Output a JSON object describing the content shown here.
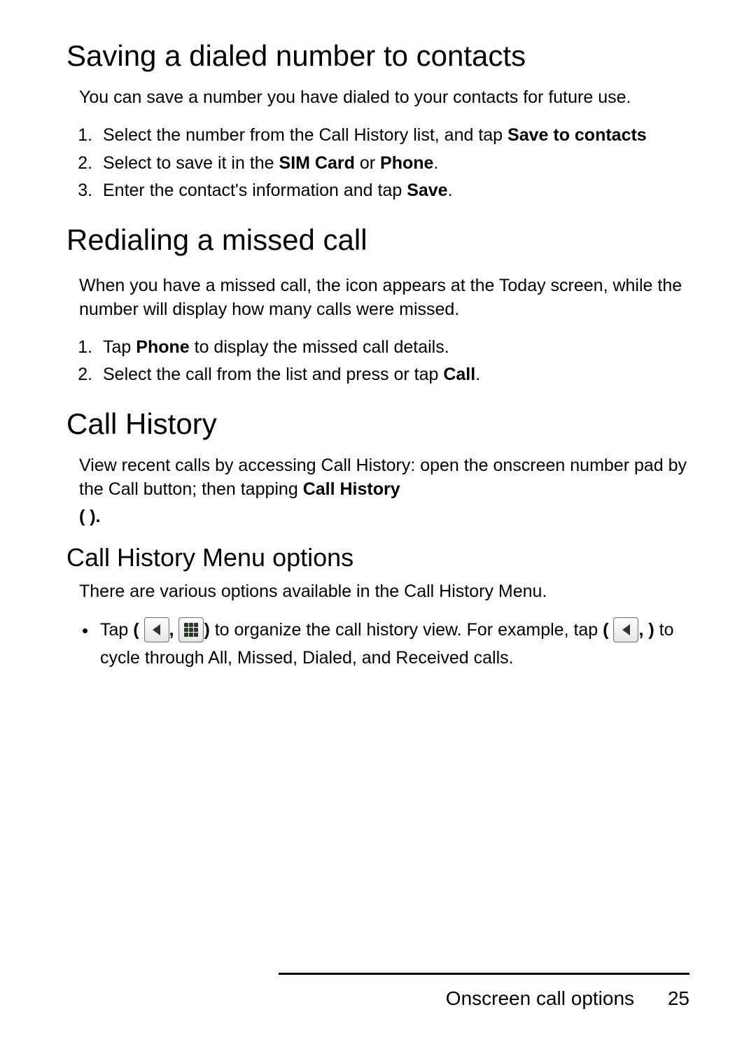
{
  "section1": {
    "heading": "Saving a dialed number to contacts",
    "intro": "You can save a number you have dialed to your contacts for future use.",
    "step1_a": "Select the number from the Call History list, and tap ",
    "step1_b": "Save to contacts",
    "step2_a": "Select to save it in the ",
    "step2_b": "SIM Card",
    "step2_c": " or ",
    "step2_d": "Phone",
    "step2_e": ".",
    "step3_a": "Enter the contact's information and tap ",
    "step3_b": "Save",
    "step3_c": "."
  },
  "section2": {
    "heading": "Redialing a missed call",
    "intro": "When you have a missed call, the        icon appears at the Today screen, while the number will display how many calls were missed.",
    "step1_a": "Tap ",
    "step1_b": "Phone",
    "step1_c": " to display the missed call details.",
    "step2_a": "Select the call from the list and press      or tap ",
    "step2_b": "Call",
    "step2_c": "."
  },
  "section3": {
    "heading": "Call History",
    "intro_a": "View recent calls by accessing Call History: open the onscreen number pad by the Call button; then tapping ",
    "intro_b": "Call History",
    "paren": "(      ).",
    "subheading": "Call History Menu options",
    "subintro": "There are various options available in the Call History Menu.",
    "bullet_a": "Tap ",
    "bullet_b": "( ",
    "bullet_c": ", ",
    "bullet_d": ")",
    "bullet_e": " to organize the call history view. For example, tap ",
    "bullet_f": "( ",
    "bullet_g": ",       )",
    "bullet_h": " to cycle through All, Missed, Dialed, and Received calls."
  },
  "footer": {
    "title": "Onscreen call options",
    "page": "25"
  }
}
